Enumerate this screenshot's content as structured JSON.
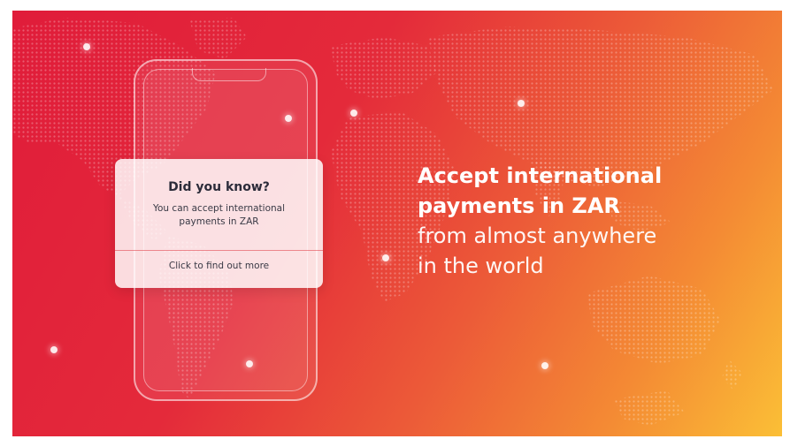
{
  "card": {
    "title": "Did you know?",
    "body_line1": "You can accept international",
    "body_line2": "payments in ZAR",
    "link": "Click to find out more"
  },
  "headline": {
    "bold_line1": "Accept international",
    "bold_line2": "payments in ZAR",
    "light_line1": "from almost anywhere",
    "light_line2": "in the world"
  },
  "colors": {
    "gradient_start": "#e01c3a",
    "gradient_mid": "#ec5a38",
    "gradient_end": "#fbbf36",
    "text": "#ffffff",
    "card_text": "#2c2c3a"
  },
  "icons": [
    "world-map-dotted-graphic",
    "phone-outline-graphic"
  ]
}
